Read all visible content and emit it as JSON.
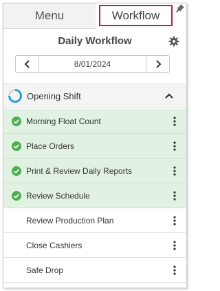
{
  "tabs": [
    {
      "label": "Menu",
      "active": false
    },
    {
      "label": "Workflow",
      "active": true
    }
  ],
  "accent_color": "#b0253f",
  "complete_color": "#4caf50",
  "title": "Daily Workflow",
  "date": "8/01/2024",
  "shift": {
    "label": "Opening Shift",
    "expanded": true
  },
  "tasks": [
    {
      "label": "Morning Float Count",
      "done": true
    },
    {
      "label": "Place Orders",
      "done": true
    },
    {
      "label": "Print & Review Daily Reports",
      "done": true
    },
    {
      "label": "Review Schedule",
      "done": true
    },
    {
      "label": "Review Production Plan",
      "done": false
    },
    {
      "label": "Close Cashiers",
      "done": false
    },
    {
      "label": "Safe Drop",
      "done": false
    }
  ]
}
